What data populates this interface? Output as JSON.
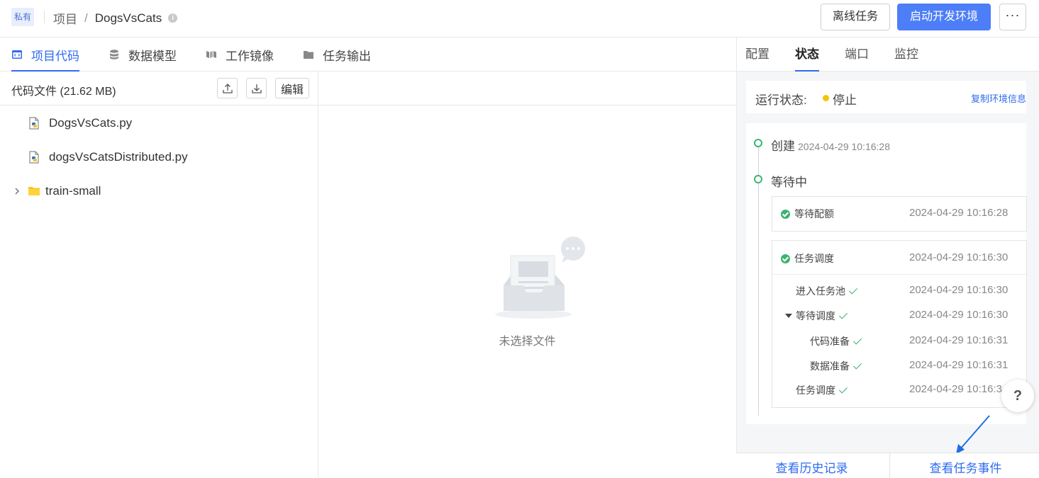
{
  "header": {
    "badge": "私有",
    "breadcrumb_root": "项目",
    "breadcrumb_sep": "/",
    "project_name": "DogsVsCats",
    "offline_task_label": "离线任务",
    "start_env_label": "启动开发环境",
    "more_label": "···"
  },
  "tabs": [
    {
      "label": "项目代码",
      "icon": "code-file-icon",
      "active": true
    },
    {
      "label": "数据模型",
      "icon": "database-icon",
      "active": false
    },
    {
      "label": "工作镜像",
      "icon": "image-icon",
      "active": false
    },
    {
      "label": "任务输出",
      "icon": "folder-icon",
      "active": false
    }
  ],
  "files": {
    "title": "代码文件 (21.62 MB)",
    "edit_label": "编辑",
    "items": [
      {
        "name": "DogsVsCats.py",
        "type": "python-file"
      },
      {
        "name": "dogsVsCatsDistributed.py",
        "type": "python-file"
      },
      {
        "name": "train-small",
        "type": "folder"
      }
    ]
  },
  "preview": {
    "empty_text": "未选择文件"
  },
  "right_tabs": [
    {
      "label": "配置",
      "active": false
    },
    {
      "label": "状态",
      "active": true
    },
    {
      "label": "端口",
      "active": false
    },
    {
      "label": "监控",
      "active": false
    }
  ],
  "status": {
    "label": "运行状态:",
    "value": "停止",
    "dot_color": "#f5c400",
    "copy_link": "复制环境信息"
  },
  "timeline": {
    "created_label": "创建",
    "created_time": "2024-04-29 10:16:28",
    "waiting_label": "等待中",
    "quota": {
      "label": "等待配额",
      "time": "2024-04-29 10:16:28"
    },
    "schedule": {
      "label": "任务调度",
      "time": "2024-04-29 10:16:30"
    },
    "steps": [
      {
        "label": "进入任务池",
        "time": "2024-04-29 10:16:30"
      },
      {
        "label": "等待调度",
        "time": "2024-04-29 10:16:30"
      },
      {
        "label": "代码准备",
        "time": "2024-04-29 10:16:31"
      },
      {
        "label": "数据准备",
        "time": "2024-04-29 10:16:31"
      },
      {
        "label": "任务调度",
        "time": "2024-04-29 10:16:3"
      }
    ]
  },
  "help_label": "?",
  "footer": {
    "history_label": "查看历史记录",
    "events_label": "查看任务事件"
  },
  "colors": {
    "primary": "#4d7ef7",
    "link": "#2f6bf0",
    "success": "#3cb371",
    "arrow": "#1e6fe0"
  }
}
